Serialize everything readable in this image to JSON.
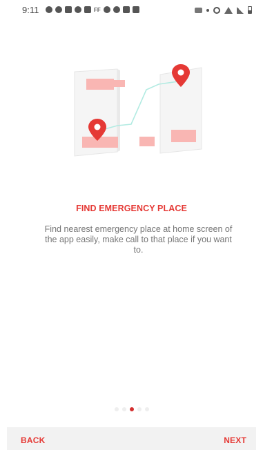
{
  "status_bar": {
    "time": "9:11",
    "left_icons": [
      "whatsapp-icon",
      "messenger-icon",
      "book-icon",
      "facebook-icon",
      "image-icon",
      "ff-icon",
      "settings-icon",
      "messenger-icon",
      "phone-icon",
      "key-icon"
    ],
    "ff_text": "FF",
    "right_icons": [
      "camera-icon",
      "dot-icon",
      "alarm-icon",
      "wifi-icon",
      "signal-icon",
      "battery-icon"
    ]
  },
  "onboarding": {
    "title": "FIND EMERGENCY PLACE",
    "description": "Find nearest emergency place at home screen of the app easily, make call to that place if you want to."
  },
  "page_indicator": {
    "total": 5,
    "active_index": 2
  },
  "navigation": {
    "back_label": "BACK",
    "next_label": "NEXT"
  },
  "colors": {
    "accent": "#e53935",
    "pin": "#e53935",
    "map_block": "#f9b6b3",
    "route": "#b2ebe2",
    "bar_background": "#f2f2f2"
  }
}
